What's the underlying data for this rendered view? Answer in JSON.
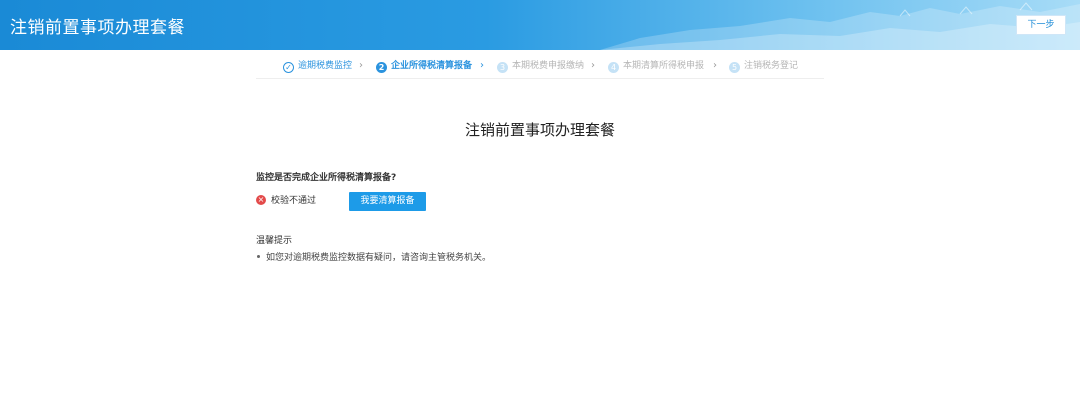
{
  "header": {
    "title": "注销前置事项办理套餐",
    "next_label": "下一步"
  },
  "steps": [
    {
      "label": "逾期税费监控",
      "state": "done",
      "icon": "check-icon"
    },
    {
      "number": "2",
      "label": "企业所得税清算报备",
      "state": "active"
    },
    {
      "number": "3",
      "label": "本期税费申报缴纳",
      "state": "todo"
    },
    {
      "number": "4",
      "label": "本期清算所得税申报",
      "state": "todo"
    },
    {
      "number": "5",
      "label": "注销税务登记",
      "state": "todo"
    }
  ],
  "main": {
    "title": "注销前置事项办理套餐",
    "question": "监控是否完成企业所得税清算报备?",
    "status_icon": "error-icon",
    "status_text": "校验不通过",
    "action_label": "我要清算报备"
  },
  "tips": {
    "title": "温馨提示",
    "items": [
      "如您对逾期税费监控数据有疑问，请咨询主管税务机关。"
    ]
  },
  "colors": {
    "header_blue": "#1a8ad6",
    "accent": "#2b93de",
    "button": "#1d9be8",
    "error": "#e34a4a"
  }
}
